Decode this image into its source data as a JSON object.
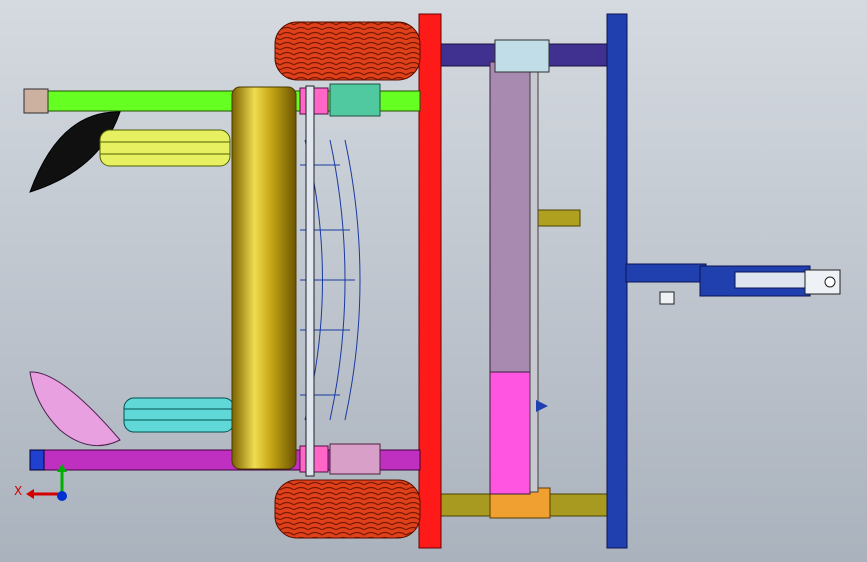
{
  "viewport": {
    "background_top": "#d5dae0",
    "background_bottom": "#aab2bd"
  },
  "triad": {
    "x_label": "X",
    "x_color": "#d40000",
    "y_color": "#00b000",
    "z_color": "#0030d0"
  },
  "model_colors": {
    "tire": "#e0401a",
    "red_frame": "#ff1a1a",
    "blue_frame": "#2040b0",
    "green_arm": "#66ff22",
    "magenta_arm": "#c030c0",
    "gold_roller": "#c8a818",
    "purple_box": "#a88ab0",
    "pink_box": "#ff55e0",
    "olive": "#b0a020",
    "navy_bar": "#403090",
    "disc_yellow": "#e6f060",
    "disc_cyan": "#60d8d8",
    "plate_pink": "#e8a0e0"
  }
}
